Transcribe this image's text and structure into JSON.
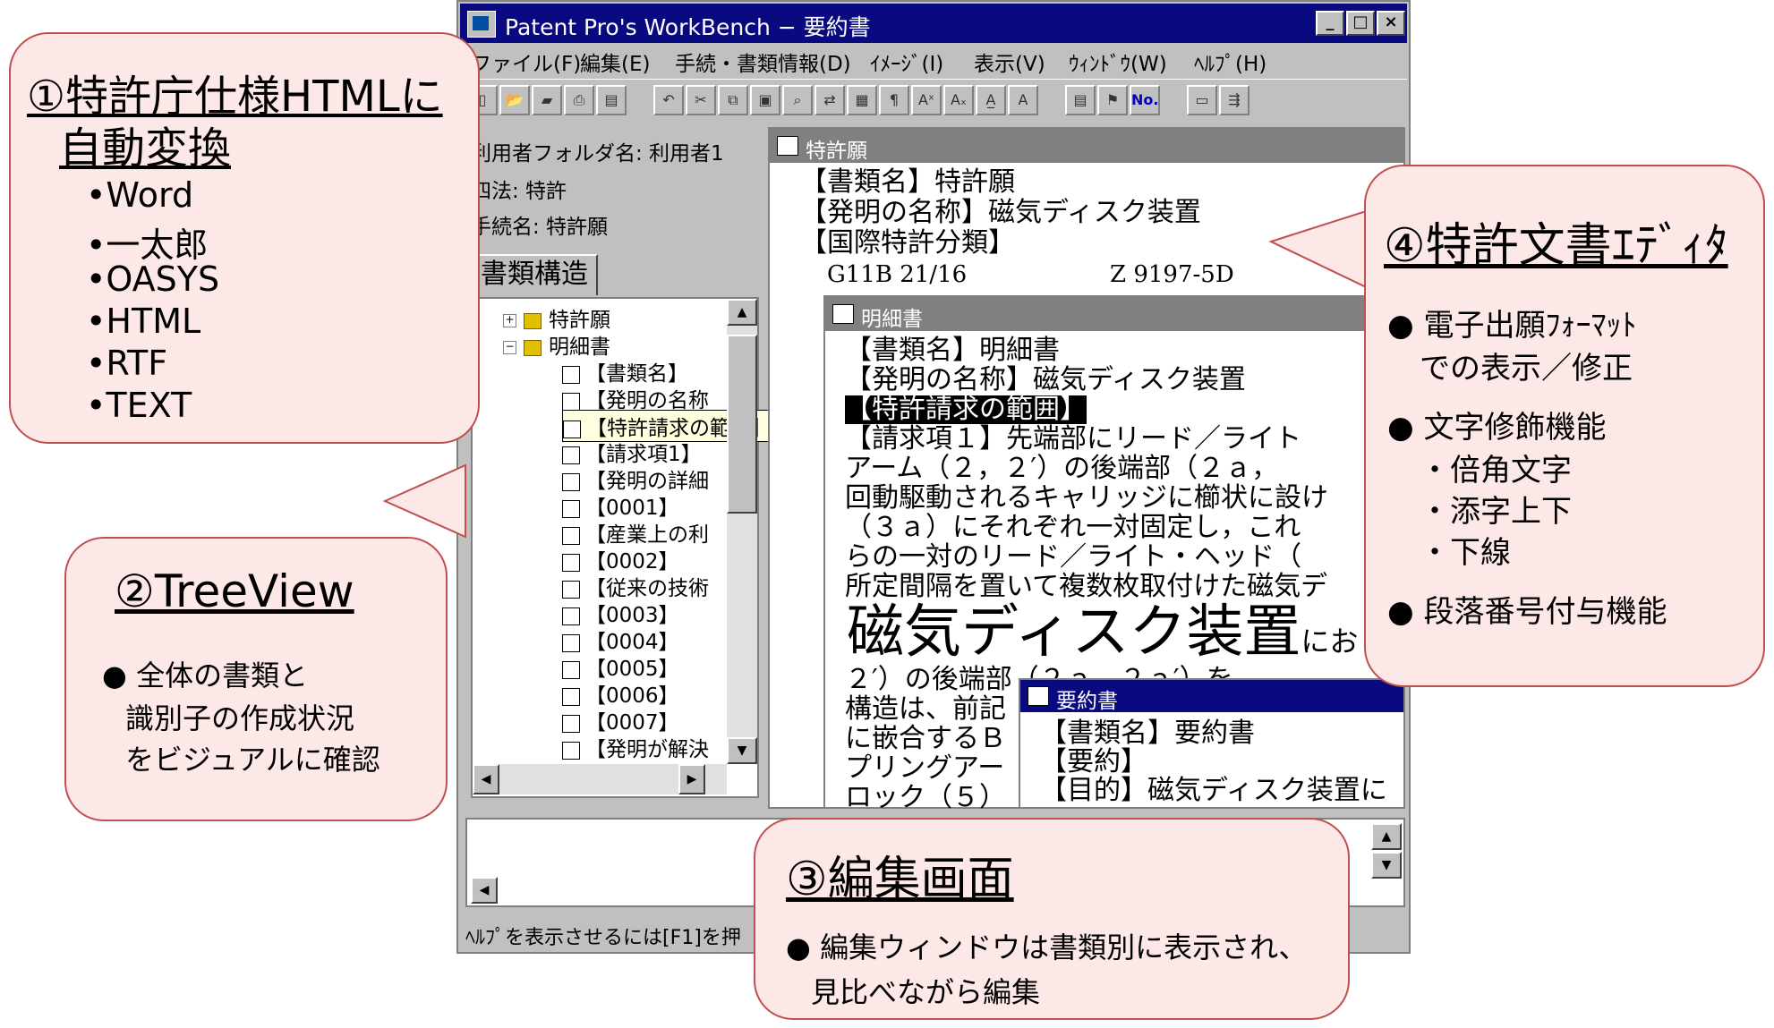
{
  "window": {
    "title": "Patent Pro's WorkBench − 要約書",
    "controls": [
      "_",
      "□",
      "×"
    ]
  },
  "menu": [
    "ファイル(F)",
    "編集(E)",
    "手続・書類情報(D)",
    "ｲﾒｰｼﾞ(I)",
    "表示(V)",
    "ｳｨﾝﾄﾞｳ(W)",
    "ﾍﾙﾌﾟ(H)"
  ],
  "info": {
    "folder": "利用者フォルダ名:  利用者1",
    "law": "四法:  特許",
    "procedure": "手続名:  特許願"
  },
  "tab_label": "書類構造",
  "tree": {
    "root1": "特許願",
    "root2": "明細書",
    "children": [
      "【書類名】",
      "【発明の名称",
      "【特許請求の範囲】",
      "【請求項1】",
      "【発明の詳細",
      "【0001】",
      "【産業上の利",
      "【0002】",
      "【従来の技術",
      "【0003】",
      "【0004】",
      "【0005】",
      "【0006】",
      "【0007】",
      "【発明が解決"
    ]
  },
  "doc_tokkyo": {
    "title": "特許願",
    "lines": [
      "【書類名】特許願",
      "【発明の名称】磁気ディスク装置",
      "【国際特許分類】",
      "G11B 21/16",
      "Z 9197-5D"
    ]
  },
  "doc_meisai": {
    "title": "明細書",
    "lines": [
      "【書類名】明細書",
      "【発明の名称】磁気ディスク装置",
      "【特許請求の範囲】",
      "【請求項１】先端部にリード／ライト",
      "アーム（２，２′）の後端部（２ａ，",
      "回動駆動されるキャリッジに櫛状に設け",
      "（３ａ）にそれぞれ一対固定し，これ",
      "らの一対のリード／ライト・ヘッド（",
      "所定間隔を置いて複数枚取付けた磁気デ"
    ],
    "big": "磁気ディスク装置",
    "big_suffix": "にお",
    "lines2": [
      "２′）の後端部（２ａ，２ａ′）を",
      "構造は、前記",
      "に嵌合するＢ",
      "プリングアー",
      "ロック（５）"
    ]
  },
  "doc_youyaku": {
    "title": "要約書",
    "lines": [
      "【書類名】要約書",
      "【要約】",
      "【目的】磁気ディスク装置に"
    ]
  },
  "status": "ﾍﾙﾌﾟを表示させるには[F1]を押",
  "callout1": {
    "title1": "①特許庁仕様HTMLに",
    "title2": "自動変換",
    "items": [
      "•Word",
      "•一太郎",
      "•OASYS",
      "•HTML",
      "•RTF",
      "•TEXT"
    ]
  },
  "callout2": {
    "title": "②TreeView",
    "lines": [
      "●  全体の書類と",
      "識別子の作成状況",
      "をビジュアルに確認"
    ]
  },
  "callout3": {
    "title": "③編集画面",
    "lines": [
      "●  編集ウィンドウは書類別に表示され、",
      "見比べながら編集"
    ]
  },
  "callout4": {
    "title": "④特許文書ｴﾃﾞｨﾀ",
    "lines": [
      "●  電子出願ﾌｫｰﾏｯﾄ",
      "での表示／修正",
      "●  文字修飾機能",
      "・倍角文字",
      "・添字上下",
      "・下線",
      "●  段落番号付与機能"
    ]
  },
  "colors": {
    "titlebar": "#0a0a80",
    "callout_fill": "#fde8e8",
    "callout_border": "#c0504d",
    "chrome": "#c0c0c0"
  }
}
